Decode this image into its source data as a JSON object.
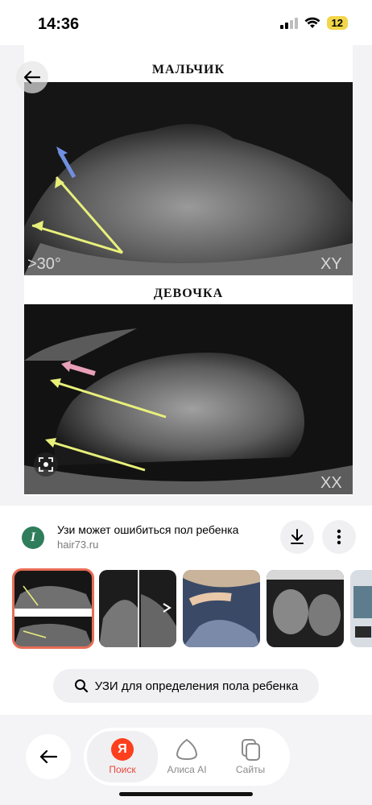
{
  "status_bar": {
    "time": "14:36",
    "battery": "12"
  },
  "image": {
    "label_top": "МАЛЬЧИК",
    "label_bottom": "ДЕВОЧКА",
    "angle_text": ">30°",
    "code_top": "XY",
    "code_bottom": "XX"
  },
  "source": {
    "logo_letter": "I",
    "title": "Узи может ошибиться пол ребенка",
    "domain": "hair73.ru"
  },
  "related_query": "УЗИ для определения пола ребенка",
  "nav": {
    "search_logo": "Я",
    "search_label": "Поиск",
    "alice_label": "Алиса AI",
    "sites_label": "Сайты"
  },
  "colors": {
    "accent": "#e8483a",
    "yandex_red": "#fc3f1d",
    "arrow_yellow": "#e8f07a",
    "selected_border": "#e86c55"
  }
}
